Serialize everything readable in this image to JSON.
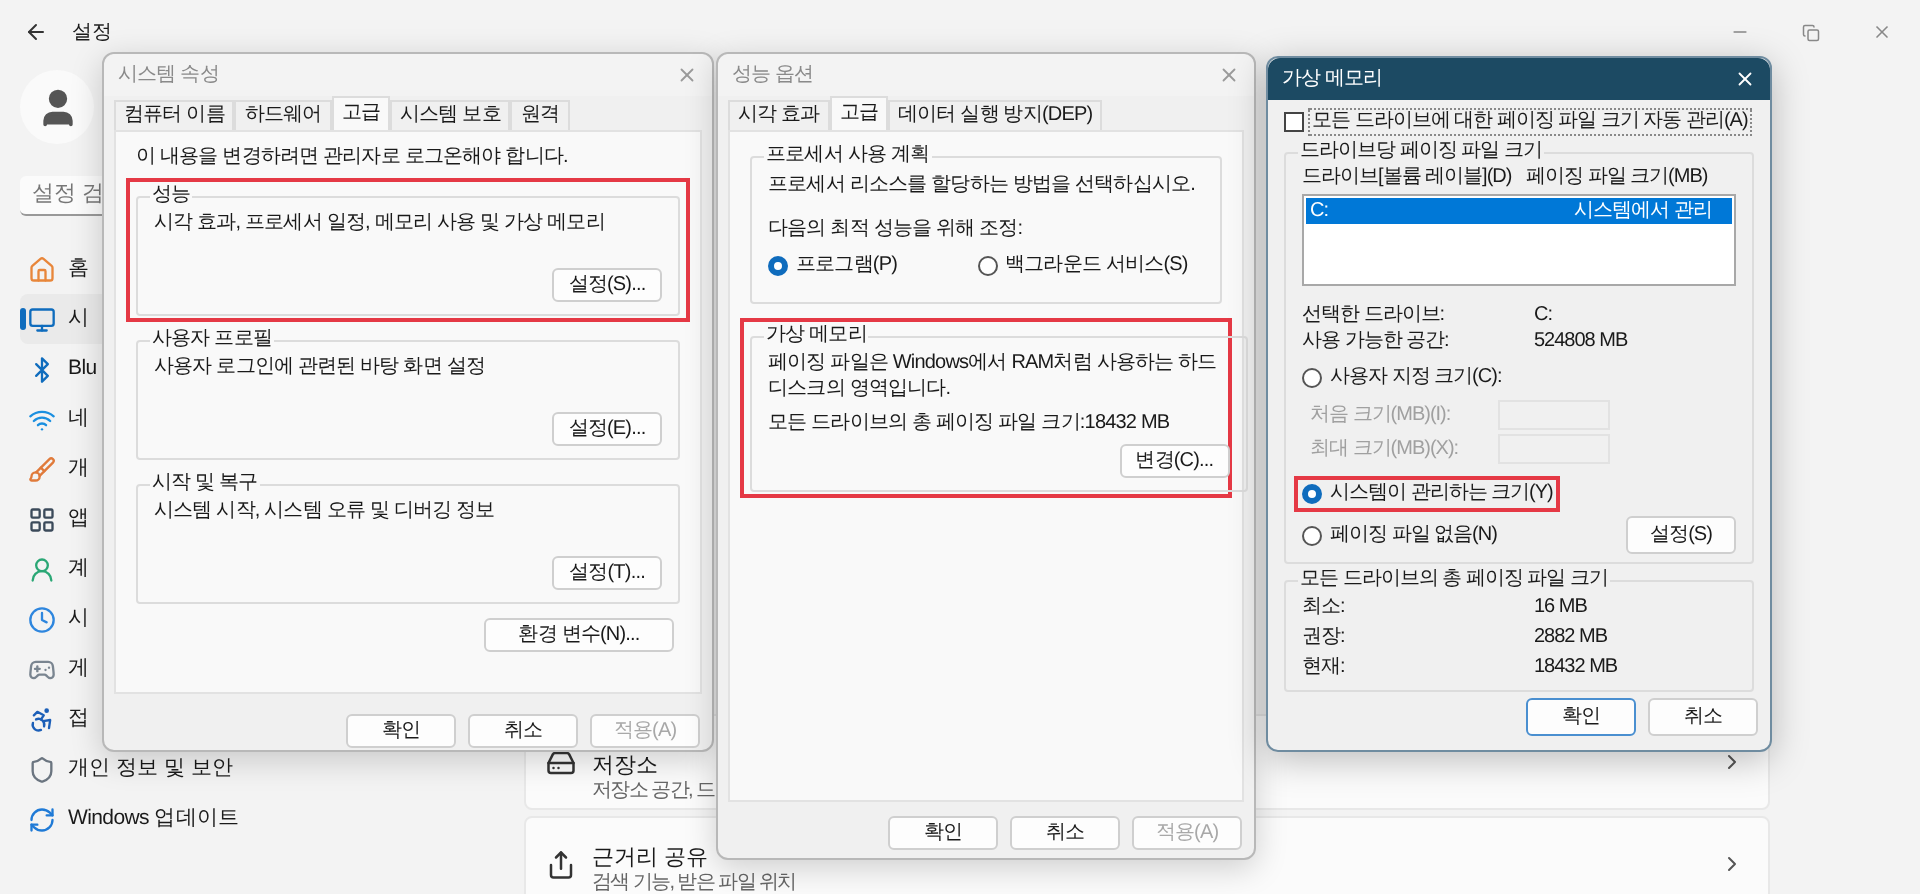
{
  "settings_app": {
    "title": "설정",
    "search": {
      "placeholder": "설정 검"
    },
    "nav": [
      {
        "label": "홈",
        "selected": false
      },
      {
        "label": "시",
        "selected": true
      },
      {
        "label": "Blu",
        "selected": false
      },
      {
        "label": "네",
        "selected": false
      },
      {
        "label": "개",
        "selected": false
      },
      {
        "label": "앱",
        "selected": false
      },
      {
        "label": "계",
        "selected": false
      },
      {
        "label": "시",
        "selected": false
      },
      {
        "label": "게",
        "selected": false
      },
      {
        "label": "접",
        "selected": false
      },
      {
        "label": "개인 정보 및 보안",
        "selected": false
      },
      {
        "label": "Windows 업데이트",
        "selected": false
      }
    ],
    "cards": [
      {
        "title": "저장소",
        "subtitle": "저장소 공간, 드"
      },
      {
        "title": "근거리 공유",
        "subtitle": "검색 기능, 받은 파일 위치"
      }
    ]
  },
  "system_properties": {
    "title": "시스템 속성",
    "active": false,
    "tabs": [
      {
        "label": "컴퓨터 이름",
        "selected": false
      },
      {
        "label": "하드웨어",
        "selected": false
      },
      {
        "label": "고급",
        "selected": true
      },
      {
        "label": "시스템 보호",
        "selected": false
      },
      {
        "label": "원격",
        "selected": false
      }
    ],
    "notice": "이 내용을 변경하려면 관리자로 로그온해야 합니다.",
    "groups": [
      {
        "title": "성능",
        "description": "시각 효과, 프로세서 일정, 메모리 사용 및 가상 메모리",
        "button": "설정(S)...",
        "highlighted": true
      },
      {
        "title": "사용자 프로필",
        "description": "사용자 로그인에 관련된 바탕 화면 설정",
        "button": "설정(E)...",
        "highlighted": false
      },
      {
        "title": "시작 및 복구",
        "description": "시스템 시작, 시스템 오류 및 디버깅 정보",
        "button": "설정(T)...",
        "highlighted": false
      }
    ],
    "env_button": "환경 변수(N)...",
    "buttons": [
      {
        "label": "확인",
        "disabled": false,
        "default": false
      },
      {
        "label": "취소",
        "disabled": false,
        "default": false
      },
      {
        "label": "적용(A)",
        "disabled": true,
        "default": false
      }
    ]
  },
  "performance_options": {
    "title": "성능 옵션",
    "active": false,
    "tabs": [
      {
        "label": "시각 효과",
        "selected": false
      },
      {
        "label": "고급",
        "selected": true
      },
      {
        "label": "데이터 실행 방지(DEP)",
        "selected": false
      }
    ],
    "scheduling": {
      "title": "프로세서 사용 계획",
      "description": "프로세서 리소스를 할당하는 방법을 선택하십시오.",
      "prompt": "다음의 최적 성능을 위해 조정:",
      "options": [
        {
          "label": "프로그램(P)",
          "selected": true
        },
        {
          "label": "백그라운드 서비스(S)",
          "selected": false
        }
      ]
    },
    "virtual_memory": {
      "title": "가상 메모리",
      "description": "페이징 파일은 Windows에서 RAM처럼 사용하는 하드 디스크의 영역입니다.",
      "total_label": "모든 드라이브의 총 페이징 파일 크기:",
      "total_value": "18432 MB",
      "button": "변경(C)...",
      "highlighted": true
    },
    "buttons": [
      {
        "label": "확인",
        "disabled": false,
        "default": false
      },
      {
        "label": "취소",
        "disabled": false,
        "default": false
      },
      {
        "label": "적용(A)",
        "disabled": true,
        "default": false
      }
    ]
  },
  "virtual_memory": {
    "title": "가상 메모리",
    "active": true,
    "auto_manage": {
      "label": "모든 드라이브에 대한 페이징 파일 크기 자동 관리(A)",
      "checked": false
    },
    "per_drive": {
      "title": "드라이브당 페이징 파일 크기",
      "columns": [
        "드라이브[볼륨 레이블](D)",
        "페이징 파일 크기(MB)"
      ],
      "rows": [
        {
          "drive": "C:",
          "size": "시스템에서 관리",
          "selected": true
        }
      ],
      "info": [
        {
          "label": "선택한 드라이브:",
          "value": "C:"
        },
        {
          "label": "사용 가능한 공간:",
          "value": "524808 MB"
        }
      ],
      "custom": {
        "label": "사용자 지정 크기(C):",
        "selected": false,
        "highlighted": false
      },
      "fields": [
        {
          "label": "처음 크기(MB)(I):",
          "disabled": true
        },
        {
          "label": "최대 크기(MB)(X):",
          "disabled": true
        }
      ],
      "system_managed": {
        "label": "시스템이 관리하는 크기(Y)",
        "selected": true,
        "highlighted": true
      },
      "no_paging": {
        "label": "페이징 파일 없음(N)",
        "selected": false,
        "highlighted": false
      },
      "set_button": "설정(S)"
    },
    "totals": {
      "title": "모든 드라이브의 총 페이징 파일 크기",
      "rows": [
        {
          "label": "최소:",
          "value": "16 MB"
        },
        {
          "label": "권장:",
          "value": "2882 MB"
        },
        {
          "label": "현재:",
          "value": "18432 MB"
        }
      ]
    },
    "buttons": [
      {
        "label": "확인",
        "disabled": false,
        "default": true
      },
      {
        "label": "취소",
        "disabled": false,
        "default": false
      }
    ]
  }
}
